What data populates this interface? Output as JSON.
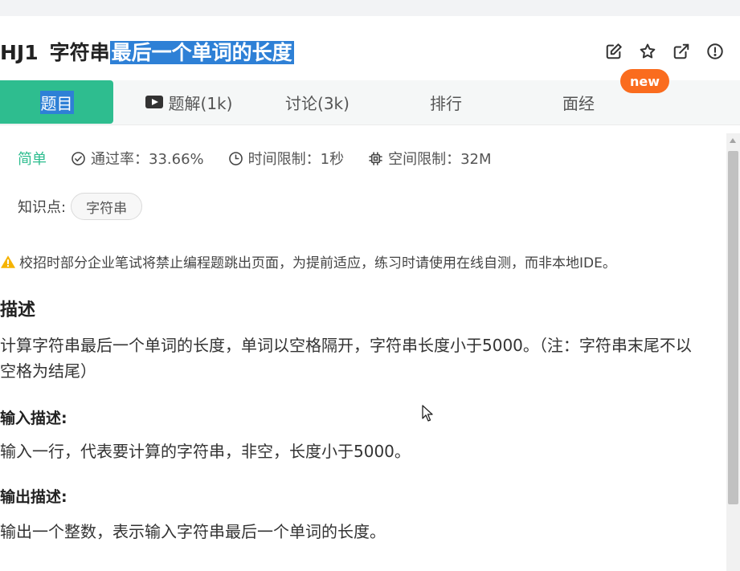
{
  "problem": {
    "code": "HJ1",
    "title_plain": "字符串",
    "title_selected": "最后一个单词的长度"
  },
  "toolbar": {
    "icons": [
      "edit-icon",
      "star-icon",
      "external-link-icon",
      "info-icon"
    ]
  },
  "new_badge": "new",
  "tabs": [
    {
      "label": "题目",
      "active": true
    },
    {
      "label": "题解(1k)",
      "icon": "video-icon"
    },
    {
      "label": "讨论(3k)"
    },
    {
      "label": "排行"
    },
    {
      "label": "面经"
    }
  ],
  "meta": {
    "difficulty": "简单",
    "pass_rate": "通过率：33.66%",
    "time_limit": "时间限制：1秒",
    "memory_limit": "空间限制：32M"
  },
  "knowledge": {
    "label": "知识点:",
    "tags": [
      "字符串"
    ]
  },
  "warning": "校招时部分企业笔试将禁止编程题跳出页面，为提前适应，练习时请使用在线自测，而非本地IDE。",
  "description": {
    "heading": "描述",
    "text": "计算字符串最后一个单词的长度，单词以空格隔开，字符串长度小于5000。（注：字符串末尾不以空格为结尾）"
  },
  "input": {
    "heading": "输入描述:",
    "text": "输入一行，代表要计算的字符串，非空，长度小于5000。"
  },
  "output": {
    "heading": "输出描述:",
    "text": "输出一个整数，表示输入字符串最后一个单词的长度。"
  },
  "colors": {
    "accent_green": "#2ebd8f",
    "selection_blue": "#2e80d6",
    "badge_orange": "#fa6c1e"
  }
}
